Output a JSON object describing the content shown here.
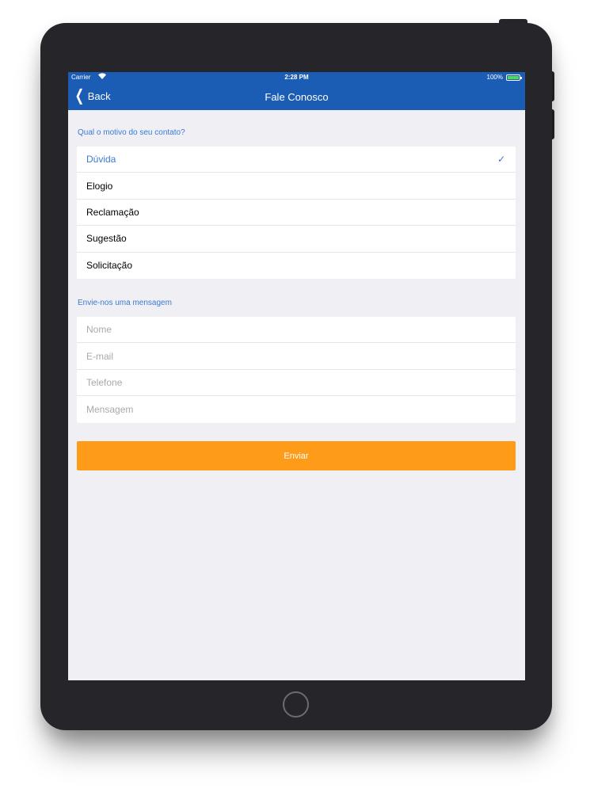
{
  "status_bar": {
    "carrier": "Carrier",
    "wifi_icon": "wifi-icon",
    "time": "2:28 PM",
    "battery_percent": "100%",
    "battery_level": 1.0
  },
  "nav": {
    "back_label": "Back",
    "back_icon": "chevron-left-icon",
    "title": "Fale Conosco"
  },
  "reason_section": {
    "header": "Qual o motivo do seu contato?",
    "options": [
      {
        "label": "Dúvida",
        "selected": true
      },
      {
        "label": "Elogio",
        "selected": false
      },
      {
        "label": "Reclamação",
        "selected": false
      },
      {
        "label": "Sugestão",
        "selected": false
      },
      {
        "label": "Solicitação",
        "selected": false
      }
    ],
    "check_icon": "checkmark-icon"
  },
  "message_section": {
    "header": "Envie-nos uma mensagem",
    "fields": [
      {
        "placeholder": "Nome",
        "value": ""
      },
      {
        "placeholder": "E-mail",
        "value": ""
      },
      {
        "placeholder": "Telefone",
        "value": ""
      },
      {
        "placeholder": "Mensagem",
        "value": ""
      }
    ]
  },
  "submit_label": "Enviar",
  "colors": {
    "nav_background": "#1b5cb5",
    "accent_blue": "#3b7bd4",
    "submit_orange": "#fe9c1a",
    "screen_background": "#efeff4",
    "device_frame": "#26262a"
  }
}
